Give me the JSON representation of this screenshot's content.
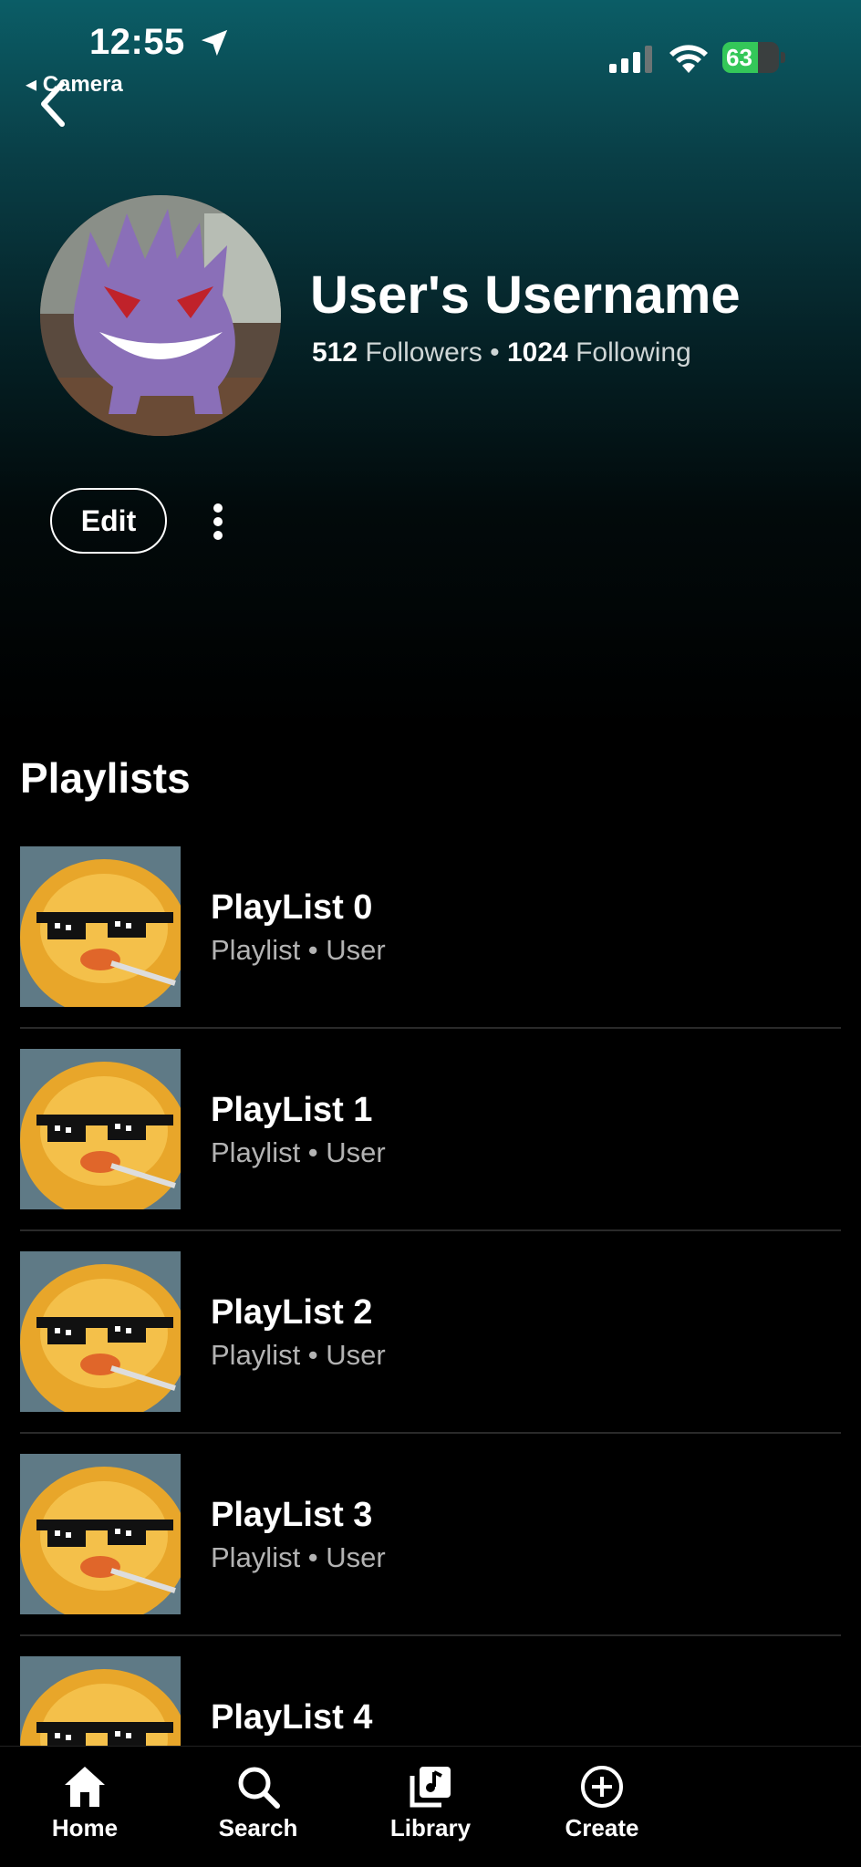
{
  "status_bar": {
    "time": "12:55",
    "back_app": "◂ Camera",
    "battery_percent": 63,
    "battery_label": "63",
    "battery_color": "#34c759"
  },
  "profile": {
    "username": "User's Username",
    "followers_count": "512",
    "followers_label": "Followers",
    "separator": "•",
    "following_count": "1024",
    "following_label": "Following",
    "edit_label": "Edit",
    "avatar_icon": "purple-ghost-avatar"
  },
  "playlists": {
    "heading": "Playlists",
    "items": [
      {
        "title": "PlayList 0",
        "subtitle": "Playlist • User"
      },
      {
        "title": "PlayList 1",
        "subtitle": "Playlist • User"
      },
      {
        "title": "PlayList 2",
        "subtitle": "Playlist • User"
      },
      {
        "title": "PlayList 3",
        "subtitle": "Playlist • User"
      },
      {
        "title": "PlayList 4",
        "subtitle": ""
      }
    ]
  },
  "tabs": [
    {
      "label": "Home",
      "icon": "home-icon"
    },
    {
      "label": "Search",
      "icon": "search-icon"
    },
    {
      "label": "Library",
      "icon": "library-icon"
    },
    {
      "label": "Create",
      "icon": "create-icon"
    }
  ],
  "colors": {
    "hero_top": "#0b5d66",
    "background": "#000000",
    "secondary_text": "#b3b3b3"
  }
}
